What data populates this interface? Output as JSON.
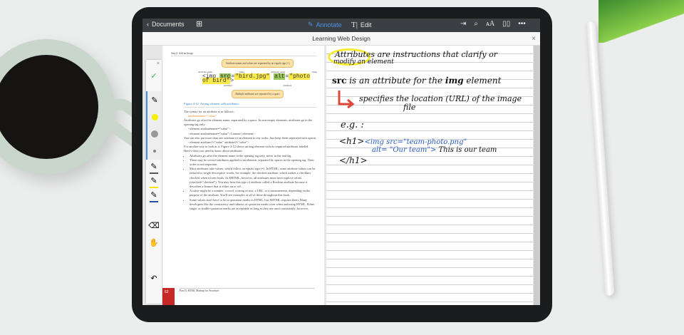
{
  "toolbar": {
    "back_label": "Documents",
    "annotate_label": "Annotate",
    "edit_label": "Edit"
  },
  "document": {
    "title": "Learning Web Design"
  },
  "left_page": {
    "running_head": "Step 6: Add an Image",
    "callout_top": "Attribute names and values are separated by an equals sign (=)",
    "callout_bottom": "Multiple attributes are separated by a space",
    "labels": {
      "attr_name": "Attribute name",
      "value": "Value",
      "attribute": "Attribute"
    },
    "code": {
      "tag": "<img ",
      "src": "src",
      "eq": "=",
      "src_val": "\"bird.jpg\"",
      "alt": "alt",
      "alt_val": "\"photo of bird\"",
      "end": ">"
    },
    "caption": "Figure 4-12. An img element with attributes.",
    "paragraphs": [
      "The syntax for an attribute is as follows:",
      "attributename=\"value\"",
      "Attributes go after the element name, separated by a space. In non-empty elements, attributes go in the opening tag only:",
      "<element attributename=\"value\">",
      "<element attributename=\"value\">Content</element>",
      "You can also put more than one attribute in an element in any order. Just keep them separated with spaces.",
      "<element attribute1=\"value\" attribute2=\"value\">",
      "For another way to look at it, Figure 4-12 shows an img element with its required attributes labeled.",
      "Here's what you need to know about attributes:"
    ],
    "bullets": [
      "Attributes go after the element name in the opening tag only, never in the end tag.",
      "There may be several attributes applied to an element, separated by spaces in the opening tag. Their order is not important.",
      "Most attributes take values, which follow an equals sign (=). In HTML, some attribute values can be reduced to single descriptive words, for example, the checked attribute, which makes a checkbox checked when a form loads. In XHTML, however, all attributes must have explicit values (checked=\"checked\"). You may hear this type of attribute called a Boolean attribute because it describes a feature that is either on or off.",
      "A value might be a number, a word, a string of text, a URL, or a measurement, depending on the purpose of the attribute. You'll see examples of all of these throughout this book.",
      "Some values don't have to be in quotation marks in HTML, but XHTML requires them. Many developers like the consistency and tidiness of quotation marks even when authoring HTML. Either single or double quotation marks are acceptable as long as they are used consistently; however,"
    ],
    "page_number": "62",
    "footer": "Part II, HTML Markup for Structure"
  },
  "notes": {
    "line1a": "Attributes",
    "line1b": " are instructions that clarify or",
    "line2": "modify an element",
    "line3a": "src",
    "line3b": " is an attribute for the ",
    "line3c": "img",
    "line3d": " element",
    "line4": "specifies the location (URL) of the image",
    "line5": "file",
    "line6": "e.g. :",
    "line7a": "<h1>",
    "line7b": "<img src=\"team-photo.png\"",
    "line8a": "alt= \"Our team\">",
    "line8b": " This is our team",
    "line9": "</h1>"
  },
  "colors": {
    "accent": "#3d8fe0",
    "highlight": "#fbe84a",
    "arrow": "#e0473a",
    "ink_blue": "#2a5bc0"
  }
}
